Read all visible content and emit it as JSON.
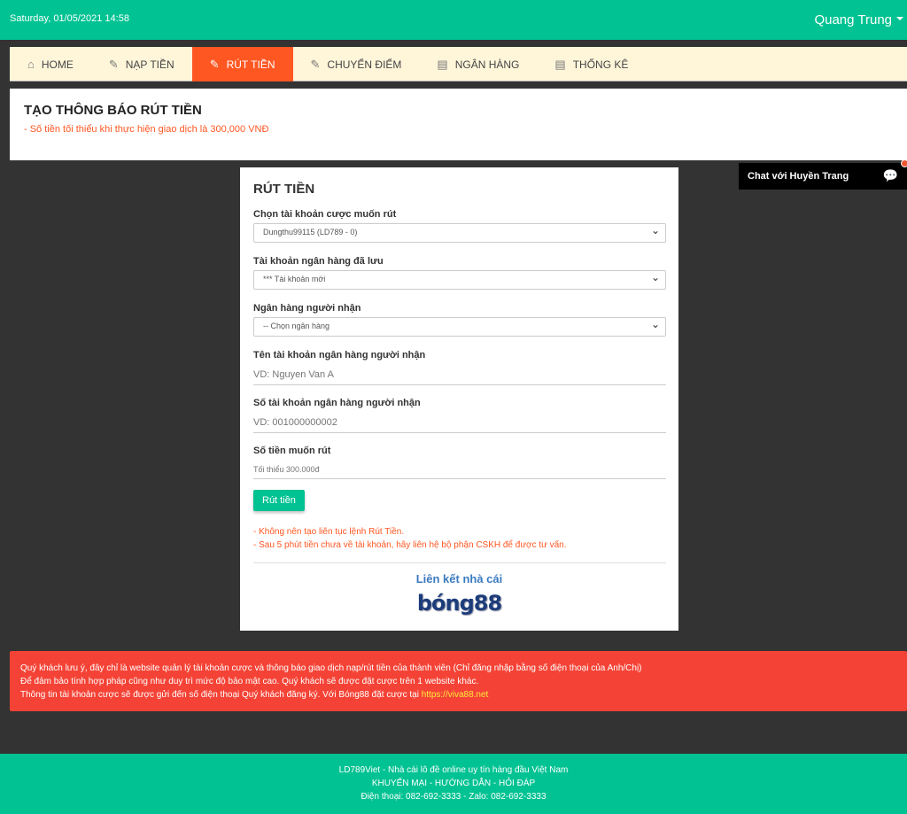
{
  "header": {
    "datetime": "Saturday, 01/05/2021 14:58",
    "user": "Quang Trung"
  },
  "nav": [
    {
      "label": "HOME",
      "icon": "home-icon"
    },
    {
      "label": "NẠP TIỀN",
      "icon": "edit-icon"
    },
    {
      "label": "RÚT TIỀN",
      "icon": "edit-icon",
      "active": true
    },
    {
      "label": "CHUYỂN ĐIỂM",
      "icon": "edit-icon"
    },
    {
      "label": "NGÂN HÀNG",
      "icon": "clipboard-icon"
    },
    {
      "label": "THỐNG KÊ",
      "icon": "clipboard-icon"
    }
  ],
  "page": {
    "title": "TẠO THÔNG BÁO RÚT TIỀN",
    "note": "- Số tiền tối thiểu khi thực hiện giao dịch là 300,000 VNĐ"
  },
  "form": {
    "title": "RÚT TIỀN",
    "account_label": "Chọn tài khoản cược muốn rút",
    "account_value": "Dungthu99115 (LD789 - 0)",
    "saved_bank_label": "Tài khoản ngân hàng đã lưu",
    "saved_bank_value": "*** Tài khoản mới",
    "bank_label": "Ngân hàng người nhận",
    "bank_value": "-- Chọn ngân hàng",
    "name_label": "Tên tài khoản ngân hàng người nhận",
    "name_placeholder": "VD: Nguyen Van A",
    "number_label": "Số tài khoản ngân hàng người nhận",
    "number_placeholder": "VD: 001000000002",
    "amount_label": "Số tiền muốn rút",
    "amount_placeholder": "Tối thiểu 300.000đ",
    "submit": "Rút tiền",
    "note1": "- Không nên tạo liên tục lệnh Rút Tiền.",
    "note2": "- Sau 5 phút tiền chưa về tài khoản, hãy liên hệ bộ phận CSKH để được tư vấn.",
    "partner_title": "Liên kết nhà cái",
    "partner_logo": "bóng88"
  },
  "chat": {
    "label": "Chat với Huyền Trang"
  },
  "alert": {
    "line1": "Quý khách lưu ý, đây chỉ là website quản lý tài khoản cược và thông báo giao dịch nạp/rút tiền của thành viên (Chỉ đăng nhập bằng số điện thoại của Anh/Chị)",
    "line2": "Để đảm bảo tính hợp pháp cũng như duy trì mức độ bảo mật cao. Quý khách sẽ được đặt cược trên 1 website khác.",
    "line3": "Thông tin tài khoản cược sẽ được gửi đến số điện thoại Quý khách đăng ký. Với Bóng88 đặt cược tại",
    "link": "https://viva88.net"
  },
  "footer": {
    "line1": "LD789Viet - Nhà cái lô đề online uy tín hàng đầu Việt Nam",
    "line2": "KHUYẾN MẠI - HƯỚNG DẪN - HỎI ĐÁP",
    "line3": "Điện thoại: 082-692-3333 - Zalo: 082-692-3333"
  }
}
